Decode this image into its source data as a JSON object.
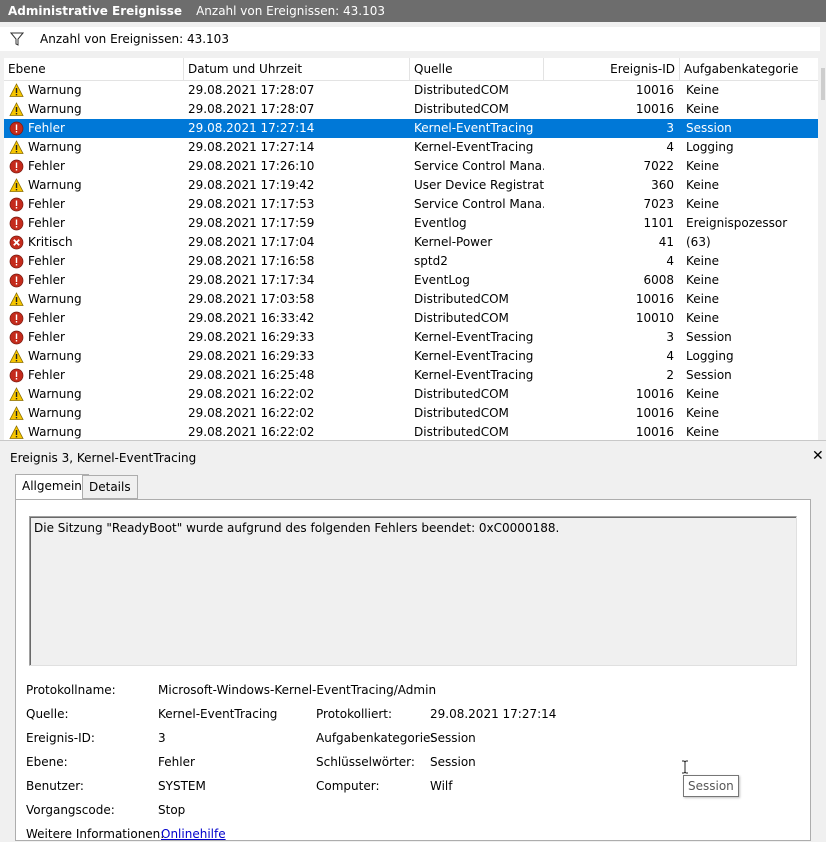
{
  "title": {
    "name": "Administrative Ereignisse",
    "count": "Anzahl von Ereignissen: 43.103"
  },
  "filter": {
    "icon": "filter-icon",
    "text": "Anzahl von Ereignissen: 43.103"
  },
  "columns": [
    "Ebene",
    "Datum und Uhrzeit",
    "Quelle",
    "Ereignis-ID",
    "Aufgabenkategorie"
  ],
  "rows": [
    {
      "level": "Warnung",
      "icon": "warning",
      "date": "29.08.2021 17:28:07",
      "source": "DistributedCOM",
      "id": "10016",
      "category": "Keine"
    },
    {
      "level": "Warnung",
      "icon": "warning",
      "date": "29.08.2021 17:28:07",
      "source": "DistributedCOM",
      "id": "10016",
      "category": "Keine"
    },
    {
      "level": "Fehler",
      "icon": "error",
      "date": "29.08.2021 17:27:14",
      "source": "Kernel-EventTracing",
      "id": "3",
      "category": "Session",
      "selected": true
    },
    {
      "level": "Warnung",
      "icon": "warning",
      "date": "29.08.2021 17:27:14",
      "source": "Kernel-EventTracing",
      "id": "4",
      "category": "Logging"
    },
    {
      "level": "Fehler",
      "icon": "error",
      "date": "29.08.2021 17:26:10",
      "source": "Service Control Mana...",
      "id": "7022",
      "category": "Keine"
    },
    {
      "level": "Warnung",
      "icon": "warning",
      "date": "29.08.2021 17:19:42",
      "source": "User Device Registrati...",
      "id": "360",
      "category": "Keine"
    },
    {
      "level": "Fehler",
      "icon": "error",
      "date": "29.08.2021 17:17:53",
      "source": "Service Control Mana...",
      "id": "7023",
      "category": "Keine"
    },
    {
      "level": "Fehler",
      "icon": "error",
      "date": "29.08.2021 17:17:59",
      "source": "Eventlog",
      "id": "1101",
      "category": "Ereignispozessor"
    },
    {
      "level": "Kritisch",
      "icon": "critical",
      "date": "29.08.2021 17:17:04",
      "source": "Kernel-Power",
      "id": "41",
      "category": "(63)"
    },
    {
      "level": "Fehler",
      "icon": "error",
      "date": "29.08.2021 17:16:58",
      "source": "sptd2",
      "id": "4",
      "category": "Keine"
    },
    {
      "level": "Fehler",
      "icon": "error",
      "date": "29.08.2021 17:17:34",
      "source": "EventLog",
      "id": "6008",
      "category": "Keine"
    },
    {
      "level": "Warnung",
      "icon": "warning",
      "date": "29.08.2021 17:03:58",
      "source": "DistributedCOM",
      "id": "10016",
      "category": "Keine"
    },
    {
      "level": "Fehler",
      "icon": "error",
      "date": "29.08.2021 16:33:42",
      "source": "DistributedCOM",
      "id": "10010",
      "category": "Keine"
    },
    {
      "level": "Fehler",
      "icon": "error",
      "date": "29.08.2021 16:29:33",
      "source": "Kernel-EventTracing",
      "id": "3",
      "category": "Session"
    },
    {
      "level": "Warnung",
      "icon": "warning",
      "date": "29.08.2021 16:29:33",
      "source": "Kernel-EventTracing",
      "id": "4",
      "category": "Logging"
    },
    {
      "level": "Fehler",
      "icon": "error",
      "date": "29.08.2021 16:25:48",
      "source": "Kernel-EventTracing",
      "id": "2",
      "category": "Session"
    },
    {
      "level": "Warnung",
      "icon": "warning",
      "date": "29.08.2021 16:22:02",
      "source": "DistributedCOM",
      "id": "10016",
      "category": "Keine"
    },
    {
      "level": "Warnung",
      "icon": "warning",
      "date": "29.08.2021 16:22:02",
      "source": "DistributedCOM",
      "id": "10016",
      "category": "Keine"
    },
    {
      "level": "Warnung",
      "icon": "warning",
      "date": "29.08.2021 16:22:02",
      "source": "DistributedCOM",
      "id": "10016",
      "category": "Keine"
    }
  ],
  "detail": {
    "title": "Ereignis 3, Kernel-EventTracing",
    "close": "✕",
    "tabs": [
      "Allgemein",
      "Details"
    ],
    "message": "Die Sitzung \"ReadyBoot\" wurde aufgrund des folgenden Fehlers beendet: 0xC0000188.",
    "props": {
      "protokollname_label": "Protokollname:",
      "protokollname": "Microsoft-Windows-Kernel-EventTracing/Admin",
      "quelle_label": "Quelle:",
      "quelle": "Kernel-EventTracing",
      "protokolliert_label": "Protokolliert:",
      "protokolliert": "29.08.2021 17:27:14",
      "id_label": "Ereignis-ID:",
      "id": "3",
      "kategorie_label": "Aufgabenkategorie:",
      "kategorie": "Session",
      "ebene_label": "Ebene:",
      "ebene": "Fehler",
      "schluessel_label": "Schlüsselwörter:",
      "schluessel": "Session",
      "benutzer_label": "Benutzer:",
      "benutzer": "SYSTEM",
      "computer_label": "Computer:",
      "computer": "Wilf",
      "vorgang_label": "Vorgangscode:",
      "vorgang": "Stop",
      "weitere_label": "Weitere Informationen:",
      "weitere_link": "Onlinehilfe"
    }
  },
  "tooltip": "Session",
  "colors": {
    "selection": "#0078d7",
    "titlebar": "#6d6d6d",
    "link": "#0000cc",
    "warning": "#f7c600",
    "error": "#c42b1c"
  }
}
